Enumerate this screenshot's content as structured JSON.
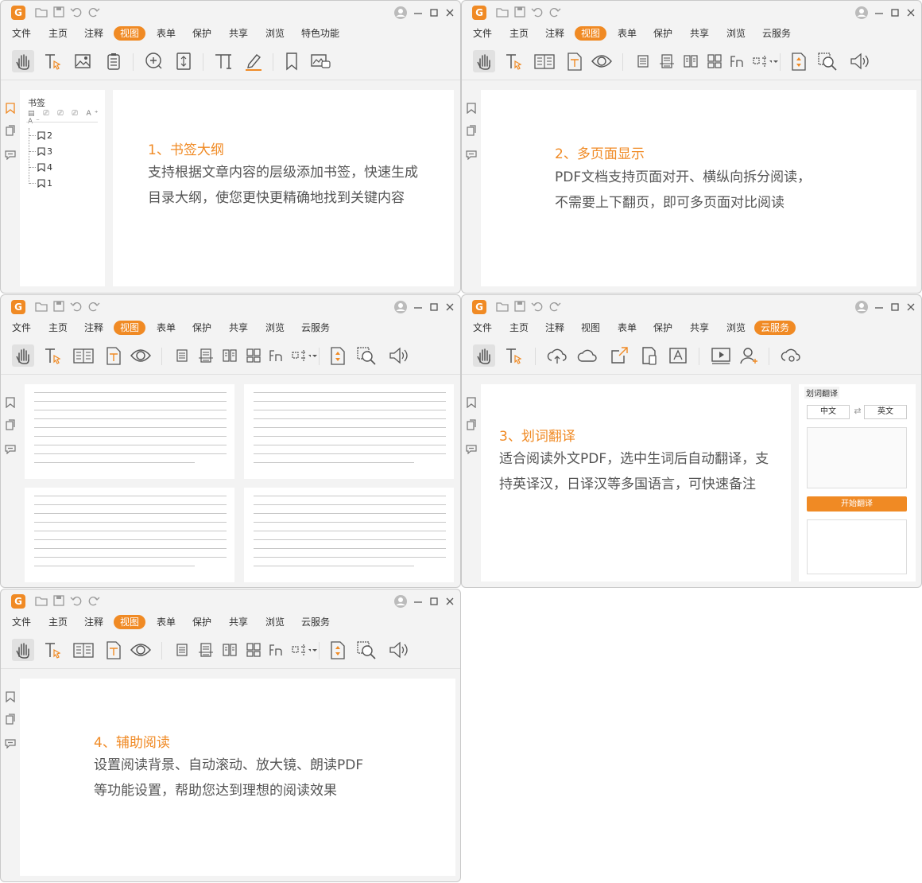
{
  "colors": {
    "accent": "#f08a24",
    "window_bg": "#f3f3f3",
    "paper": "#ffffff"
  },
  "menus": {
    "file": "文件",
    "home": "主页",
    "annotate": "注释",
    "view": "视图",
    "form": "表单",
    "protect": "保护",
    "share": "共享",
    "browse": "浏览",
    "special": "特色功能",
    "cloud": "云服务"
  },
  "window_bookmarks": {
    "panel_title": "书签",
    "bookmarks": [
      "2",
      "3",
      "4",
      "1"
    ],
    "feature_title": "1、书签大纲",
    "feature_desc": "支持根据文章内容的层级添加书签，快速生成目录大纲，使您更快更精确地找到关键内容"
  },
  "window_multipage": {
    "feature_title": "2、多页面显示",
    "feature_desc_line1": "PDF文档支持页面对开、横纵向拆分阅读，",
    "feature_desc_line2": "不需要上下翻页，即可多页面对比阅读"
  },
  "window_translate": {
    "panel_title": "划词翻译",
    "source_lang": "中文",
    "target_lang": "英文",
    "start_button": "开始翻译",
    "feature_title": "3、划词翻译",
    "feature_desc": "适合阅读外文PDF，选中生词后自动翻译，支持英译汉，日译汉等多国语言，可快速备注"
  },
  "window_assist": {
    "feature_title": "4、辅助阅读",
    "feature_desc": "设置阅读背景、自动滚动、放大镜、朗读PDF等功能设置，帮助您达到理想的阅读效果"
  },
  "icons": [
    "hand-icon",
    "select-text-icon",
    "image-icon",
    "clipboard-icon",
    "zoom-in-icon",
    "fit-page-icon",
    "typewriter-icon",
    "highlight-icon",
    "bookmark-icon",
    "screenshot-icon",
    "two-page-icon",
    "reflow-icon",
    "eye-icon",
    "single-page-icon",
    "continuous-icon",
    "facing-icon",
    "cover-icon",
    "reading-order-icon",
    "split-icon",
    "auto-scroll-icon",
    "magnifier-icon",
    "read-aloud-icon",
    "cloud-upload-icon",
    "cloud-icon",
    "share-out-icon",
    "phone-icon",
    "ocr-icon",
    "video-icon",
    "add-user-icon",
    "cloud-settings-icon",
    "user-avatar-icon",
    "minimize-icon",
    "maximize-icon",
    "close-icon"
  ]
}
